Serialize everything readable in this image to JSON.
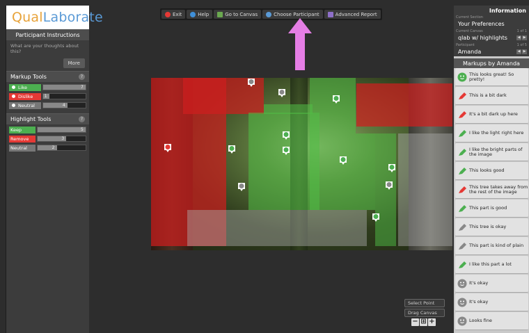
{
  "app": {
    "logo_part1": "Qual",
    "logo_part2": "Laborate",
    "brand_orange": "#e8a33a",
    "brand_blue": "#5a9ad6"
  },
  "instructions": {
    "title": "Participant Instructions",
    "question": "What are your thoughts about this?",
    "more_label": "More"
  },
  "markup_tools": {
    "title": "Markup Tools",
    "help_icon": "?",
    "items": [
      {
        "label": "Like",
        "count": "7",
        "color": "#4caf50"
      },
      {
        "label": "Dislike",
        "count": "1",
        "color": "#e53935"
      },
      {
        "label": "Neutral",
        "count": "4",
        "color": "#777777"
      }
    ]
  },
  "highlight_tools": {
    "title": "Highlight Tools",
    "help_icon": "?",
    "items": [
      {
        "label": "Keep",
        "count": "5",
        "color": "#4caf50"
      },
      {
        "label": "Remove",
        "count": "3",
        "color": "#e53935"
      },
      {
        "label": "Neutral",
        "count": "2",
        "color": "#777777"
      }
    ]
  },
  "toolbar": {
    "exit": "Exit",
    "help": "Help",
    "go_to_canvas": "Go to Canvas",
    "choose_participant": "Choose Participant",
    "advanced_report": "Advanced Report"
  },
  "info": {
    "title": "Information",
    "current_section_label": "Current Section",
    "current_section_value": "Your Preferences",
    "current_canvas_label": "Current Canvas",
    "current_canvas_count": "1 of 1",
    "current_canvas_value": "qlab w/ highlights",
    "participant_label": "Participant",
    "participant_count": "1 of 5",
    "participant_value": "Amanda"
  },
  "markups": {
    "title": "Markups by Amanda",
    "items": [
      {
        "type": "like",
        "text": "This looks great! So pretty!"
      },
      {
        "type": "remove",
        "text": "This is a bit dark"
      },
      {
        "type": "remove",
        "text": "It's a bit dark up here"
      },
      {
        "type": "keep",
        "text": "I like the light right here"
      },
      {
        "type": "keep",
        "text": "I like the bright parts of the image"
      },
      {
        "type": "keep",
        "text": "This looks good"
      },
      {
        "type": "remove",
        "text": "This tree takes away from the rest of the image"
      },
      {
        "type": "keep",
        "text": "This part is good"
      },
      {
        "type": "neutral-hl",
        "text": "This tree is okay"
      },
      {
        "type": "neutral-hl",
        "text": "This part is kind of plain"
      },
      {
        "type": "keep",
        "text": "I like this part a lot"
      },
      {
        "type": "neutral",
        "text": "It's okay"
      },
      {
        "type": "neutral",
        "text": "It's okay"
      },
      {
        "type": "neutral",
        "text": "Looks fine"
      }
    ]
  },
  "controls": {
    "select_point": "Select Point",
    "drag_canvas": "Drag Canvas",
    "zoom_out": "−",
    "zoom_reset": "⊞",
    "zoom_in": "+"
  },
  "colors": {
    "like": "#4caf50",
    "dislike": "#e53935",
    "neutral": "#888888",
    "arrow": "#e57ee5"
  }
}
